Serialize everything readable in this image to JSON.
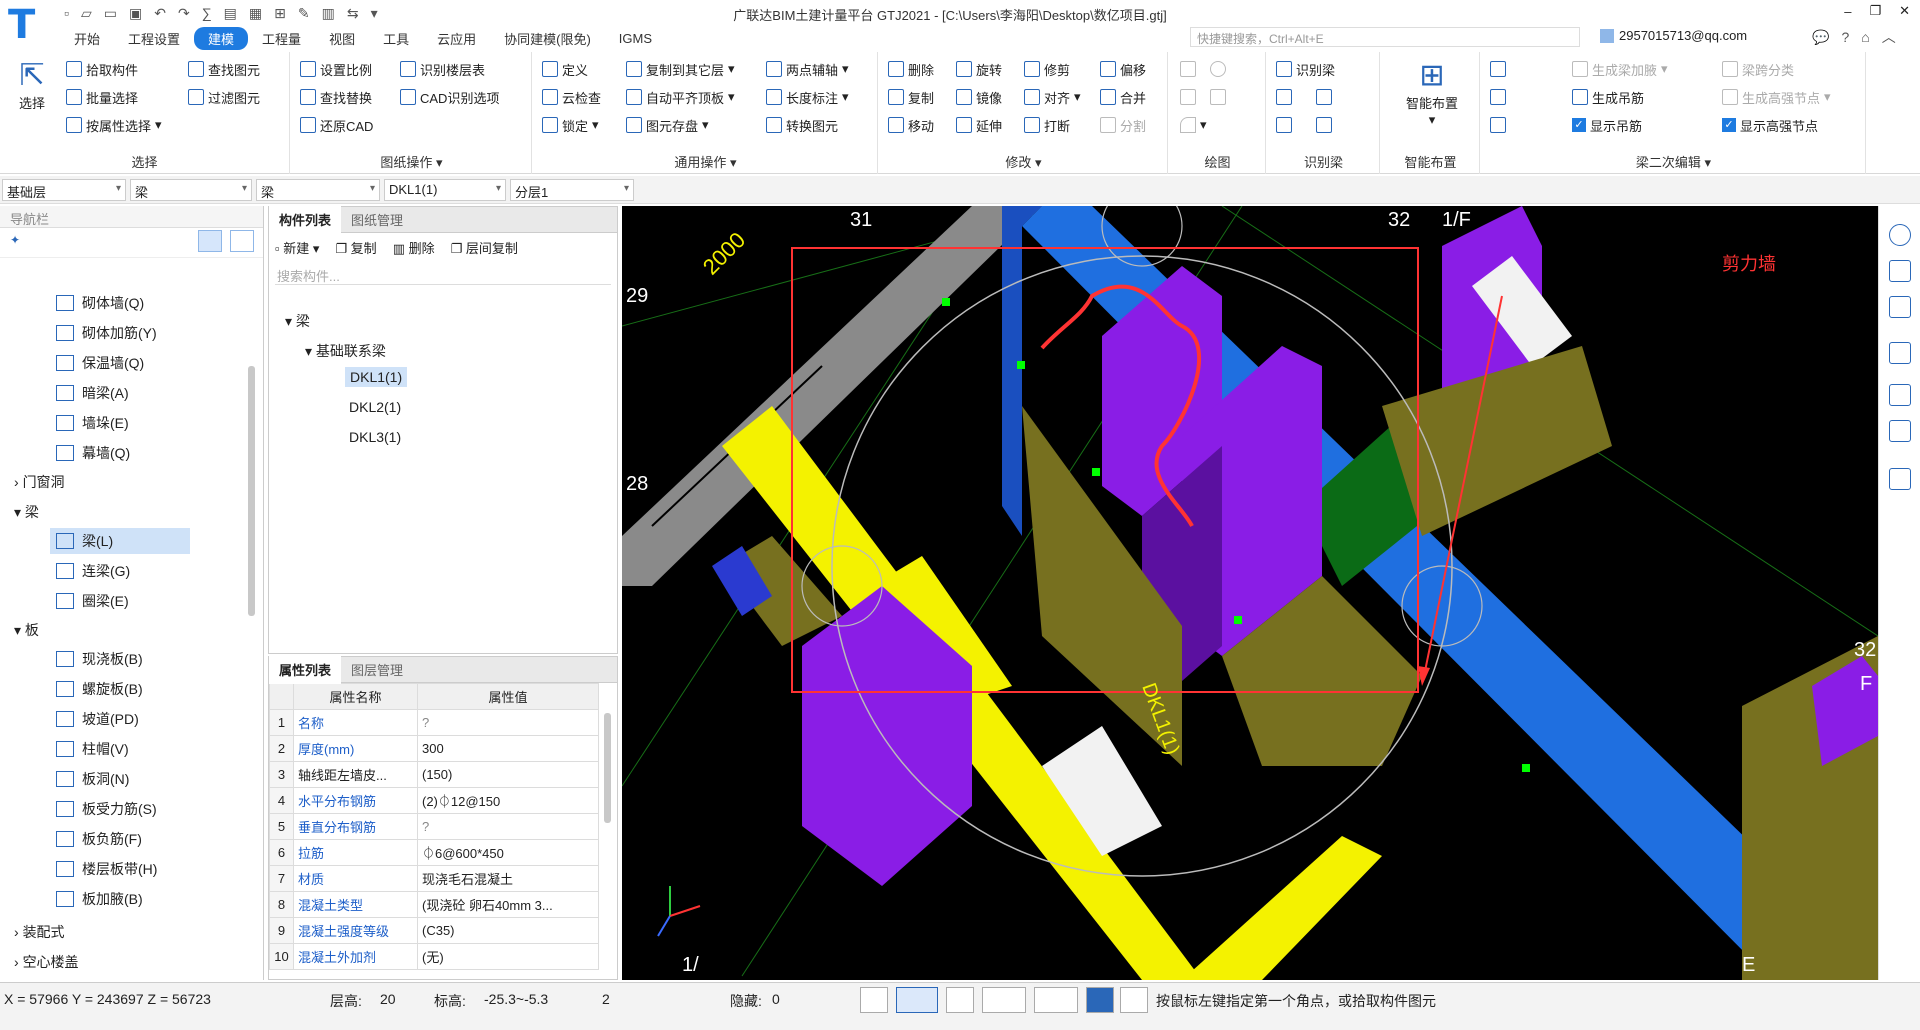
{
  "titlebar": {
    "title": "广联达BIM土建计量平台 GTJ2021 - [C:\\Users\\李海阳\\Desktop\\数亿项目.gtj]"
  },
  "menu": [
    "开始",
    "工程设置",
    "建模",
    "工程量",
    "视图",
    "工具",
    "云应用",
    "协同建模(限免)",
    "IGMS"
  ],
  "search": {
    "placeholder": "快捷键搜索，Ctrl+Alt+E"
  },
  "account": {
    "email": "2957015713@qq.com"
  },
  "ribbon": {
    "select": {
      "label": "选择",
      "items": [
        "拾取构件",
        "批量选择",
        "按属性选择",
        "查找图元",
        "过滤图元"
      ],
      "big": "选择"
    },
    "drawing_ops": {
      "label": "图纸操作",
      "items": [
        "设置比例",
        "识别楼层表",
        "查找替换",
        "CAD识别选项",
        "还原CAD"
      ]
    },
    "common_ops": {
      "label": "通用操作",
      "items": [
        "定义",
        "复制到其它层",
        "两点辅轴",
        "云检查",
        "自动平齐顶板",
        "长度标注",
        "锁定",
        "图元存盘",
        "转换图元"
      ]
    },
    "modify": {
      "label": "修改",
      "items": [
        "删除",
        "旋转",
        "修剪",
        "偏移",
        "复制",
        "镜像",
        "对齐",
        "合并",
        "移动",
        "延伸",
        "打断",
        "分割"
      ]
    },
    "draw": {
      "label": "绘图"
    },
    "identify_beam": {
      "label": "识别梁",
      "items": [
        "识别梁"
      ]
    },
    "smart_layout": {
      "label": "智能布置",
      "big": "智能布置"
    },
    "beam_edit": {
      "label": "梁二次编辑",
      "items": [
        "生成梁加腋",
        "梁跨分类",
        "生成高强节点",
        "生成吊筋",
        "显示吊筋",
        "显示高强节点"
      ]
    }
  },
  "selectors": [
    "基础层",
    "梁",
    "梁",
    "DKL1(1)",
    "分层1"
  ],
  "nav": {
    "title": "导航栏",
    "wall_items": [
      "砌体墙(Q)",
      "砌体加筋(Y)",
      "保温墙(Q)",
      "暗梁(A)",
      "墙垛(E)",
      "幕墙(Q)"
    ],
    "cat_door": "门窗洞",
    "cat_beam": "梁",
    "beam_items": [
      "梁(L)",
      "连梁(G)",
      "圈梁(E)"
    ],
    "cat_slab": "板",
    "slab_items": [
      "现浇板(B)",
      "螺旋板(B)",
      "坡道(PD)",
      "柱帽(V)",
      "板洞(N)",
      "板受力筋(S)",
      "板负筋(F)",
      "楼层板带(H)",
      "板加腋(B)"
    ],
    "cat_prefab": "装配式",
    "cat_hollow": "空心楼盖"
  },
  "component_panel": {
    "tabs": [
      "构件列表",
      "图纸管理"
    ],
    "tools": [
      "新建",
      "复制",
      "删除",
      "层间复制"
    ],
    "search_placeholder": "搜索构件...",
    "tree_root": "梁",
    "tree_group": "基础联系梁",
    "items": [
      "DKL1(1)",
      "DKL2(1)",
      "DKL3(1)"
    ]
  },
  "property_panel": {
    "tabs": [
      "属性列表",
      "图层管理"
    ],
    "headers": [
      "属性名称",
      "属性值"
    ],
    "rows": [
      [
        "1",
        "名称",
        "?"
      ],
      [
        "2",
        "厚度(mm)",
        "300"
      ],
      [
        "3",
        "轴线距左墙皮...",
        "(150)"
      ],
      [
        "4",
        "水平分布钢筋",
        "(2)⏀12@150"
      ],
      [
        "5",
        "垂直分布钢筋",
        "?"
      ],
      [
        "6",
        "拉筋",
        "⏀6@600*450"
      ],
      [
        "7",
        "材质",
        "现浇毛石混凝土"
      ],
      [
        "8",
        "混凝土类型",
        "(现浇砼 卵石40mm 3..."
      ],
      [
        "9",
        "混凝土强度等级",
        "(C35)"
      ],
      [
        "10",
        "混凝土外加剂",
        "(无)"
      ]
    ]
  },
  "viewport": {
    "annotation": "剪力墙",
    "axis_labels": [
      "31",
      "32",
      "1/F",
      "29",
      "28",
      "32",
      "F",
      "E",
      "1/",
      "2000"
    ],
    "beam_label": "DKL1(1)",
    "colors": {
      "bg": "#000000",
      "blue": "#1f6fe0",
      "purple": "#8a1de6",
      "olive": "#77701f",
      "yellow": "#f4f200",
      "gray": "#8a8a8a",
      "green": "#0b6b16",
      "red": "#ff3333"
    }
  },
  "status": {
    "coords": "X = 57966 Y = 243697 Z = 56723",
    "floor_height_label": "层高:",
    "floor_height": "20",
    "elevation_label": "标高:",
    "elevation": "-25.3~-5.3",
    "count": "2",
    "hidden_label": "隐藏:",
    "hidden": "0",
    "hint": "按鼠标左键指定第一个角点，或拾取构件图元"
  }
}
